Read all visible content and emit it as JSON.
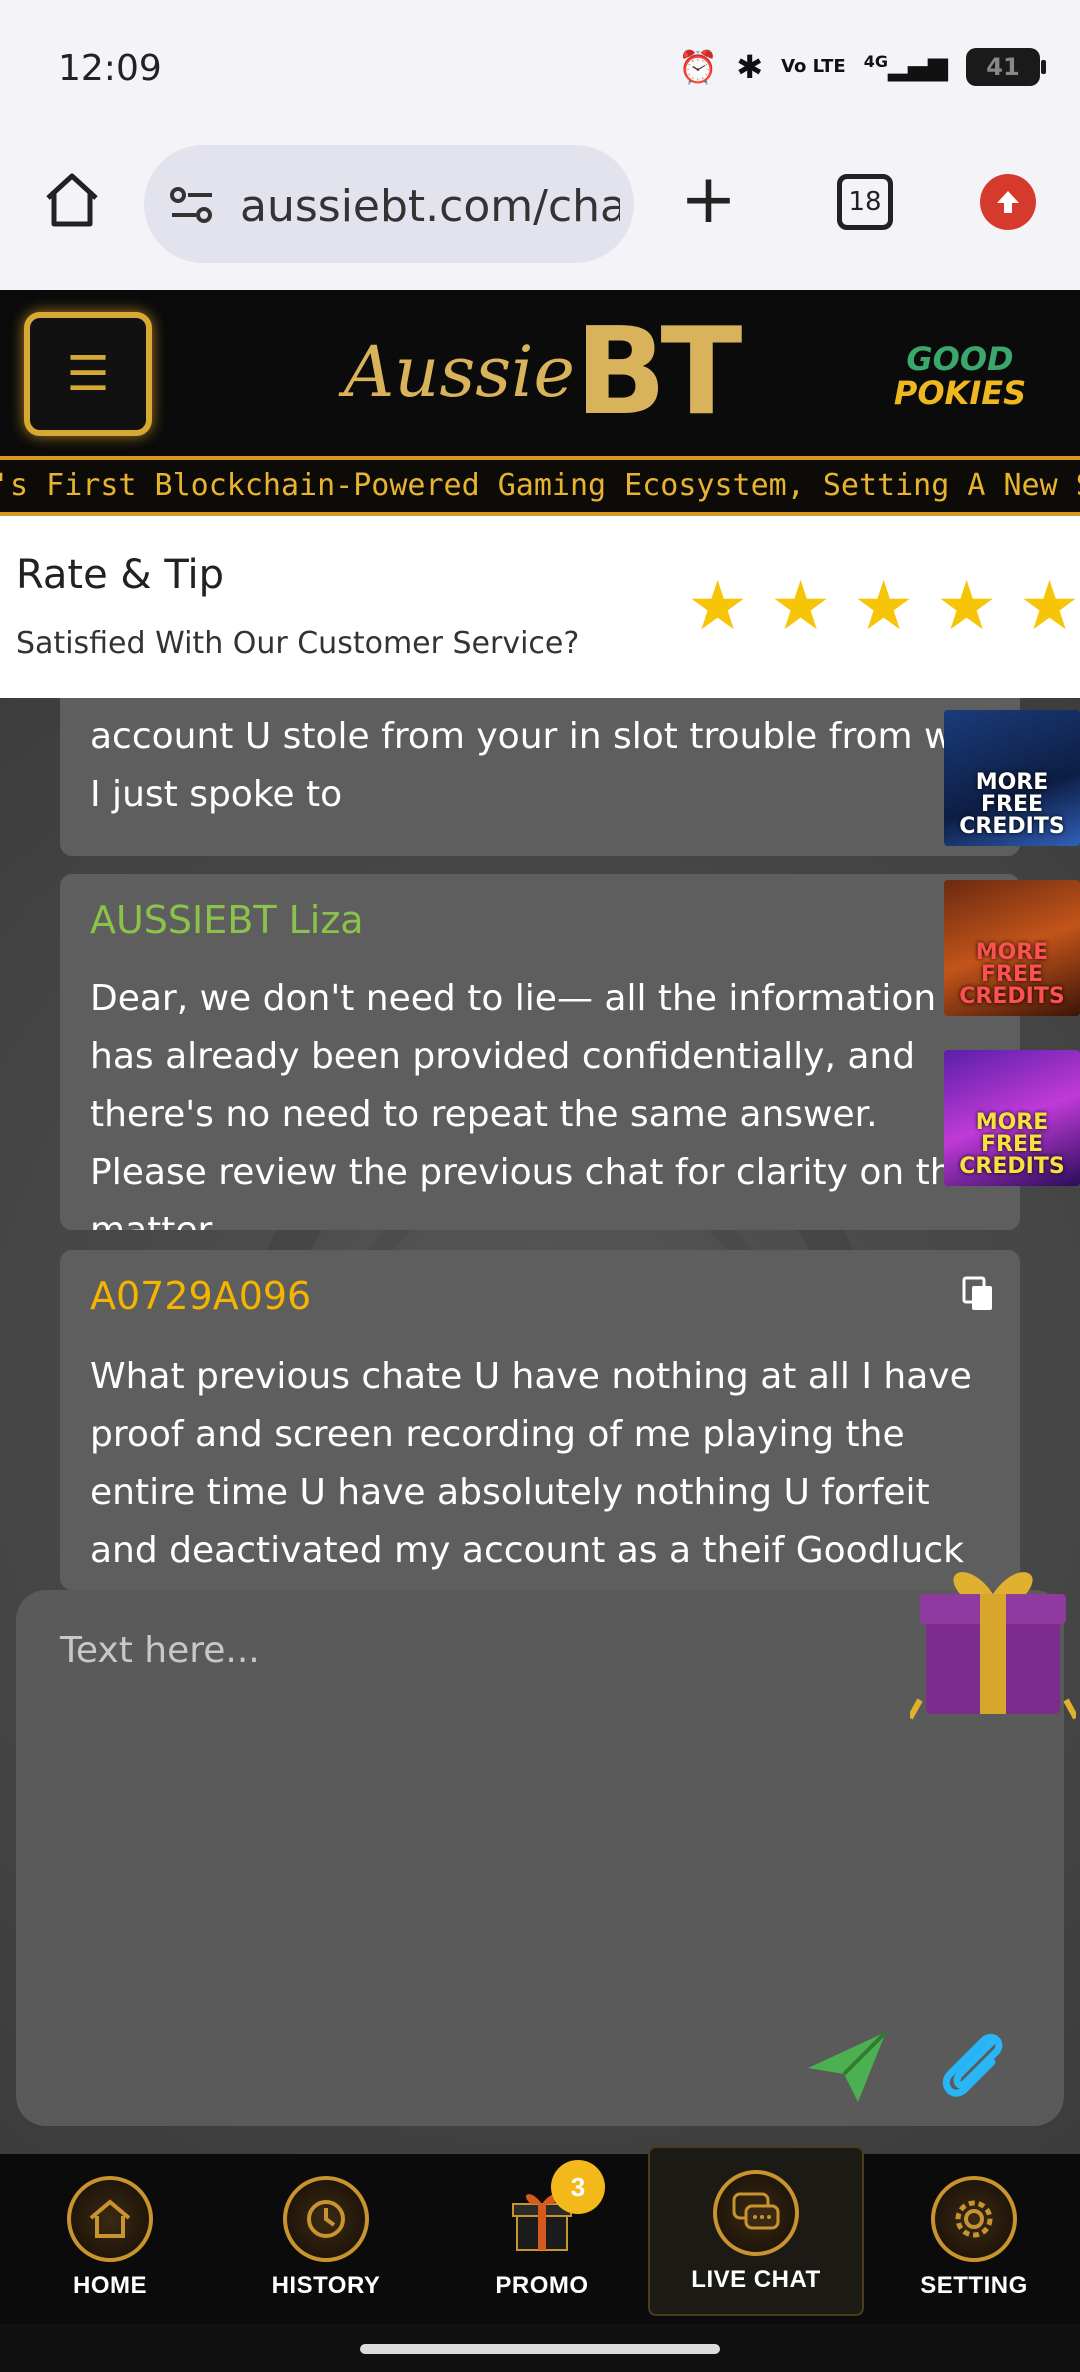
{
  "status": {
    "time": "12:09",
    "battery": "41",
    "net": "4G",
    "volte": "Vo LTE"
  },
  "browser": {
    "url": "aussiebt.com/chat",
    "tab_count": "18"
  },
  "site": {
    "brand_script": "Aussie",
    "brand_bt": "BT",
    "partner_line1": "GOOD",
    "partner_line2": "POKIES",
    "ticker": "'s First Blockchain-Powered Gaming Ecosystem, Setting A New Standard For"
  },
  "rate": {
    "title": "Rate & Tip",
    "subtitle": "Satisfied With Our Customer Service?",
    "stars": 5
  },
  "messages": [
    {
      "body": "account U stole from your in slot trouble from who I just spoke to"
    },
    {
      "name": "AUSSIEBT Liza",
      "name_color": "#8bc34a",
      "body": "Dear, we don't need to lie— all the information has already been provided confidentially, and there's no need to repeat the same answer. Please review the previous chat for clarity on this matter."
    },
    {
      "name": "A0729A096",
      "name_color": "#f4b400",
      "body": "What previous chate U have nothing at all I have proof and screen recording of me playing the entire time U have absolutely nothing U forfeit and deactivated my account as a theif Goodluck ur"
    }
  ],
  "promos": [
    {
      "label": "MORE FREE CREDITS",
      "icon": "slot-game-thumbnail"
    },
    {
      "label": "MORE FREE CREDITS",
      "icon": "slot-game-thumbnail"
    },
    {
      "label": "MORE FREE CREDITS",
      "icon": "slot-game-thumbnail"
    }
  ],
  "input": {
    "placeholder": "Text here..."
  },
  "nav": {
    "home": "HOME",
    "history": "HISTORY",
    "promo": "PROMO",
    "promo_badge": "3",
    "live_chat": "LIVE CHAT",
    "setting": "SETTING"
  },
  "colors": {
    "accent_gold": "#d6a934",
    "star": "#f7c508",
    "send": "#4caf50",
    "attach": "#29b6f6"
  }
}
